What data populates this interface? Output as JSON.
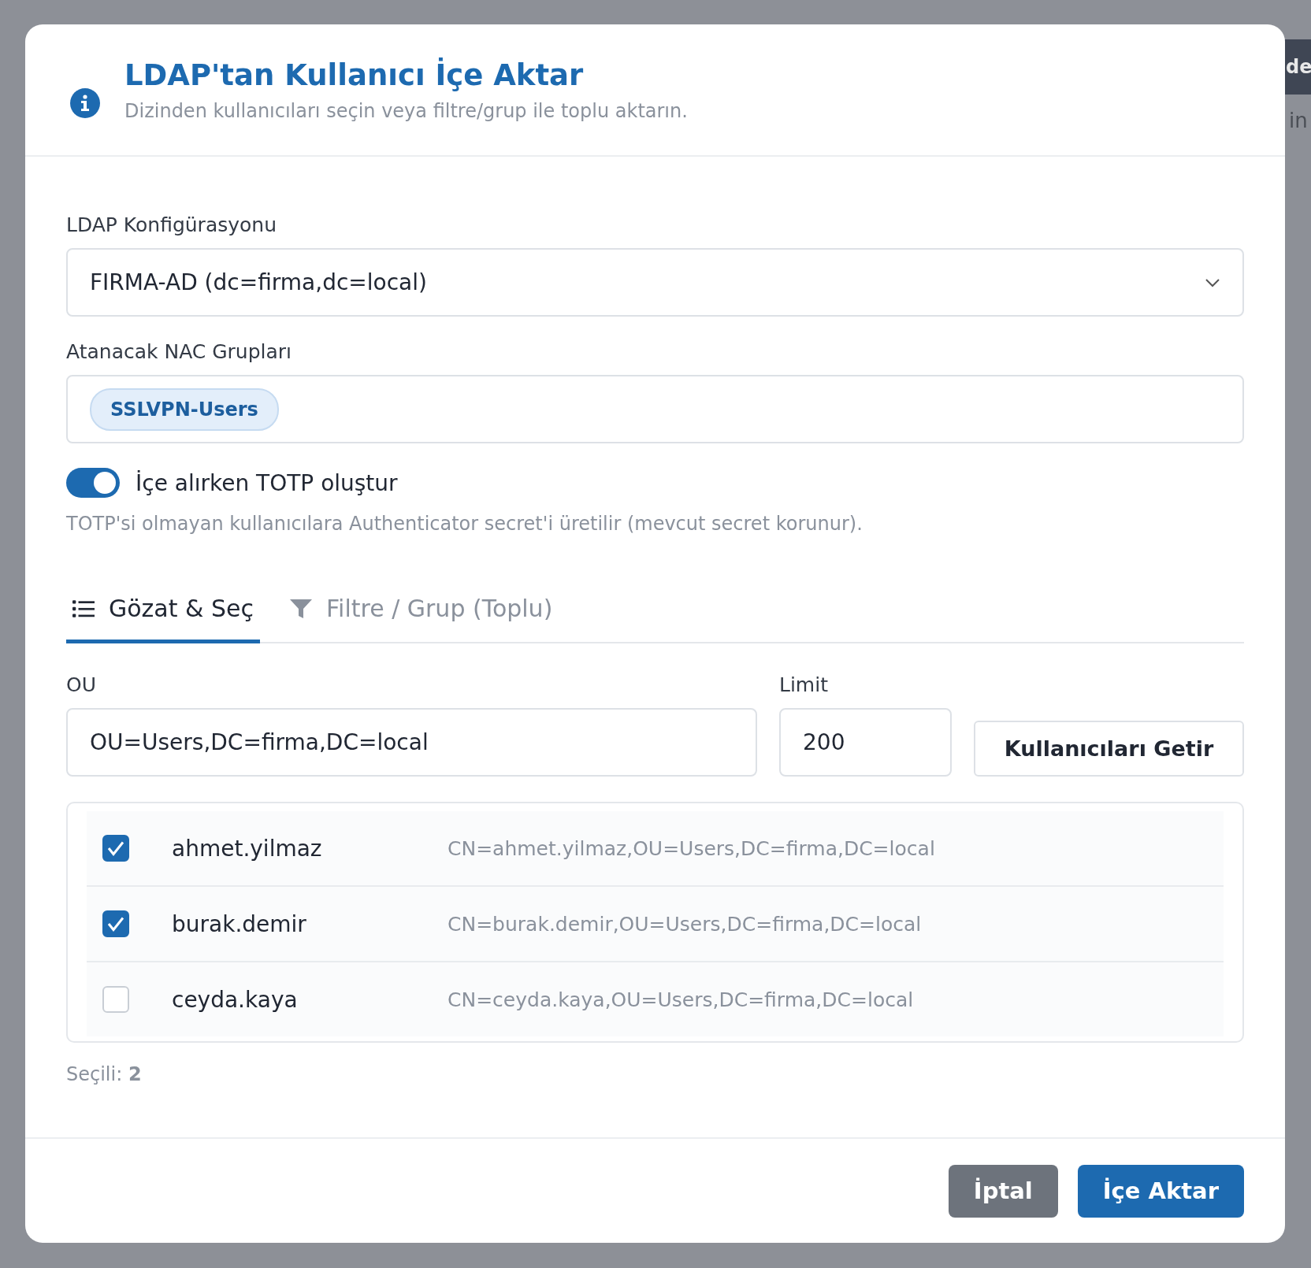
{
  "background": {
    "header_text": "de",
    "text": "in"
  },
  "dialog": {
    "title": "LDAP'tan Kullanıcı İçe Aktar",
    "subtitle": "Dizinden kullanıcıları seçin veya filtre/grup ile toplu aktarın."
  },
  "config": {
    "label": "LDAP Konfigürasyonu",
    "value": "FIRMA-AD (dc=firma,dc=local)"
  },
  "groups": {
    "label": "Atanacak NAC Grupları",
    "tags": [
      "SSLVPN-Users"
    ]
  },
  "totp": {
    "label": "İçe alırken TOTP oluştur",
    "on": true,
    "hint": "TOTP'si olmayan kullanıcılara Authenticator secret'i üretilir (mevcut secret korunur)."
  },
  "tabs": [
    {
      "label": "Gözat & Seç",
      "kind": "list",
      "selected": true
    },
    {
      "label": "Filtre / Grup (Toplu)",
      "kind": "filter",
      "selected": false
    }
  ],
  "ou": {
    "label": "OU",
    "value": "OU=Users,DC=firma,DC=local"
  },
  "limit": {
    "label": "Limit",
    "value": "200"
  },
  "fetch_button": "Kullanıcıları Getir",
  "users": [
    {
      "name": "ahmet.yilmaz",
      "dn": "CN=ahmet.yilmaz,OU=Users,DC=firma,DC=local",
      "checked": true
    },
    {
      "name": "burak.demir",
      "dn": "CN=burak.demir,OU=Users,DC=firma,DC=local",
      "checked": true
    },
    {
      "name": "ceyda.kaya",
      "dn": "CN=ceyda.kaya,OU=Users,DC=firma,DC=local",
      "checked": false
    }
  ],
  "selected_count": "Seçili: **2**",
  "buttons": {
    "cancel": "İptal",
    "submit": "İçe Aktar"
  }
}
